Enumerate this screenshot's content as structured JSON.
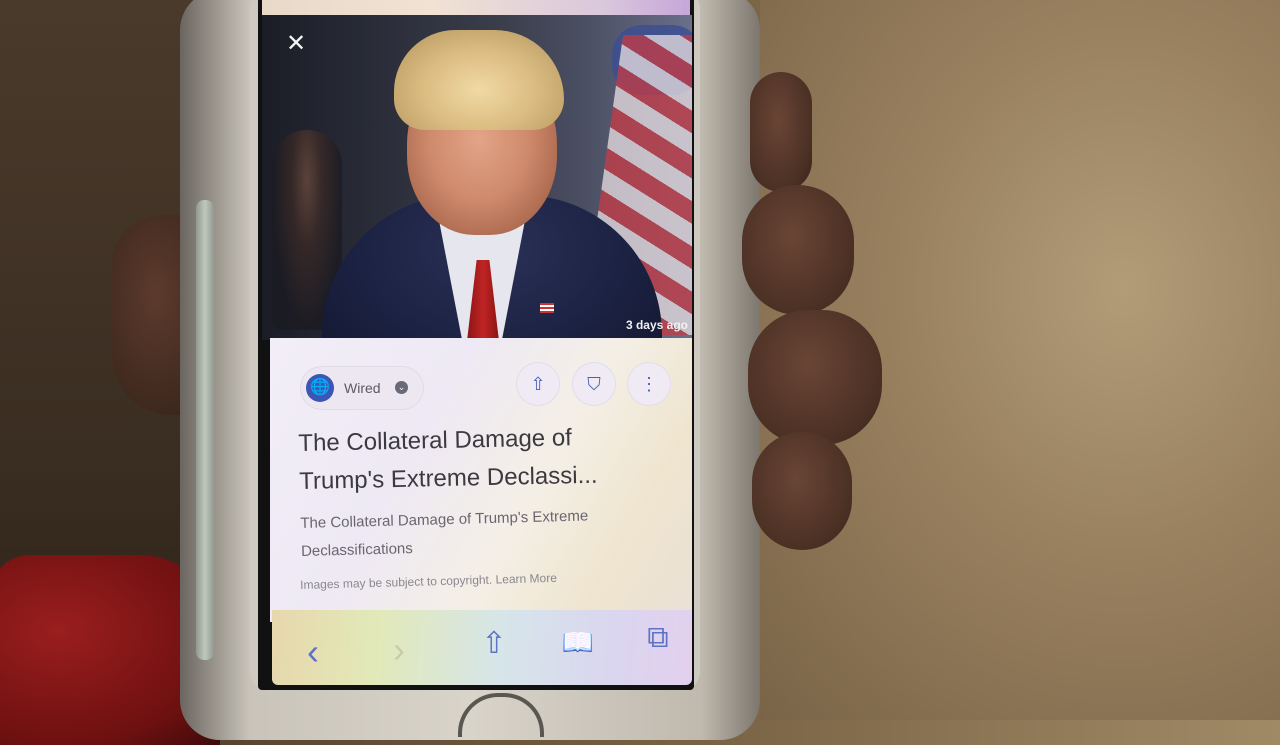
{
  "overlay": {
    "close_glyph": "✕",
    "timestamp": "3 days ago"
  },
  "card": {
    "source": "Wired",
    "source_menu_glyph": "⌄",
    "actions": {
      "share_glyph": "⇧",
      "bookmark_glyph": "⛉",
      "more_glyph": "⋮"
    },
    "headline_line1": "The Collateral Damage of",
    "headline_line2": "Trump's Extreme Declassi...",
    "snippet_line1": "The Collateral Damage of Trump's Extreme",
    "snippet_line2": "Declassifications",
    "copyright_note": "Images may be subject to copyright. Learn More"
  },
  "toolbar": {
    "back_glyph": "‹",
    "forward_glyph": "›",
    "share_glyph": "⇧",
    "bookmarks_glyph": "📖",
    "tabs_glyph": "⧉"
  }
}
